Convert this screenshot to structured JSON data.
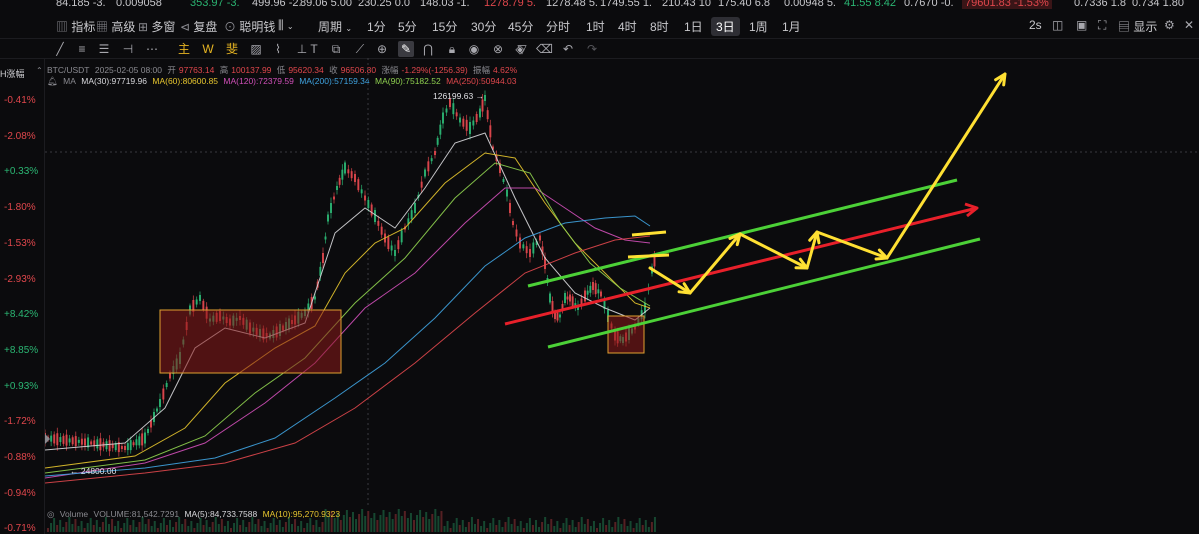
{
  "ticker": [
    {
      "text": "84.185  -3.",
      "color": "#c8c8cc"
    },
    {
      "text": "0.009058",
      "color": "#c8c8cc"
    },
    {
      "text": "353.97  -3.",
      "color": "#2bb673"
    },
    {
      "text": "499.96  -2.",
      "color": "#c8c8cc"
    },
    {
      "text": "89.06  5.00",
      "color": "#c8c8cc"
    },
    {
      "text": "230.25  0.0",
      "color": "#c8c8cc"
    },
    {
      "text": "148.03  -1.",
      "color": "#c8c8cc"
    },
    {
      "text": "1278.79  5.",
      "color": "#e0474c"
    },
    {
      "text": "1278.48  5.",
      "color": "#c8c8cc"
    },
    {
      "text": "1749.55  1.",
      "color": "#c8c8cc"
    },
    {
      "text": "210.43  10",
      "color": "#c8c8cc"
    },
    {
      "text": "175.40  6.8",
      "color": "#c8c8cc"
    },
    {
      "text": "0.00948  5.",
      "color": "#c8c8cc"
    },
    {
      "text": "41.55  8.42",
      "color": "#2bb673"
    },
    {
      "text": "0.7670  -0.",
      "color": "#c8c8cc"
    },
    {
      "text": "79601.83  -1.53%",
      "color": "#e0474c"
    },
    {
      "text": "0.7336  1.8",
      "color": "#c8c8cc"
    },
    {
      "text": "0.734  1.80",
      "color": "#c8c8cc"
    }
  ],
  "toolbar": {
    "indicators": "指标",
    "advanced": "高级",
    "multi_window": "多窗",
    "review": "复盘",
    "smart_money": "聪明钱",
    "period": "周期",
    "intervals": [
      "1分",
      "5分",
      "15分",
      "30分",
      "45分",
      "分时",
      "1时",
      "4时",
      "8时",
      "1日",
      "3日",
      "1周",
      "1月"
    ],
    "active_interval": "3日",
    "refresh_rate": "2s",
    "display": "显示"
  },
  "drawing_tools": {
    "main": "主",
    "wave": "W",
    "fib": "斐"
  },
  "axis": {
    "title": "H涨幅",
    "labels": [
      {
        "text": "-0.41%",
        "color": "#e0474c"
      },
      {
        "text": "-2.08%",
        "color": "#e0474c"
      },
      {
        "text": "+0.33%",
        "color": "#2bb673"
      },
      {
        "text": "-1.80%",
        "color": "#e0474c"
      },
      {
        "text": "-1.53%",
        "color": "#e0474c"
      },
      {
        "text": "-2.93%",
        "color": "#e0474c"
      },
      {
        "text": "+8.42%",
        "color": "#2bb673"
      },
      {
        "text": "+8.85%",
        "color": "#2bb673"
      },
      {
        "text": "+0.93%",
        "color": "#2bb673"
      },
      {
        "text": "-1.72%",
        "color": "#e0474c"
      },
      {
        "text": "-0.88%",
        "color": "#e0474c"
      },
      {
        "text": "-0.94%",
        "color": "#e0474c"
      },
      {
        "text": "-0.71%",
        "color": "#e0474c"
      }
    ]
  },
  "ohlc": {
    "symbol": "BTC/USDT",
    "date": "2025-02-05 08:00",
    "open_label": "开",
    "open": "97763.14",
    "high_label": "高",
    "high": "100137.99",
    "low_label": "低",
    "low": "95620.34",
    "close_label": "收",
    "close": "96506.80",
    "change_label": "涨幅",
    "change": "-1.29%(-1256.39)",
    "amplitude_label": "振幅",
    "amplitude": "4.62%"
  },
  "ma_legend": {
    "label": "MA",
    "items": [
      {
        "text": "MA(30):97719.96",
        "color": "#d8d8dc"
      },
      {
        "text": "MA(60):80600.85",
        "color": "#e6c52e"
      },
      {
        "text": "MA(120):72379.59",
        "color": "#d04fb8"
      },
      {
        "text": "MA(200):57159.34",
        "color": "#3fa3e0"
      },
      {
        "text": "MA(90):75182.52",
        "color": "#8fd14f"
      },
      {
        "text": "MA(250):50944.03",
        "color": "#e0474c"
      }
    ]
  },
  "annotations": {
    "peak": "126199.63",
    "low": "24800.00"
  },
  "volume": {
    "label": "Volume",
    "value": "VOLUME:81,542.7291",
    "ma5": "MA(5):84,733.7588",
    "ma10": "MA(10):95,270.9323"
  },
  "colors": {
    "up": "#2bb673",
    "down": "#e0474c",
    "channel": "#4cd137",
    "midline": "#e8202a",
    "projection": "#ffe033",
    "box_fill": "#8a1a1a",
    "box_border": "#e0a030"
  }
}
